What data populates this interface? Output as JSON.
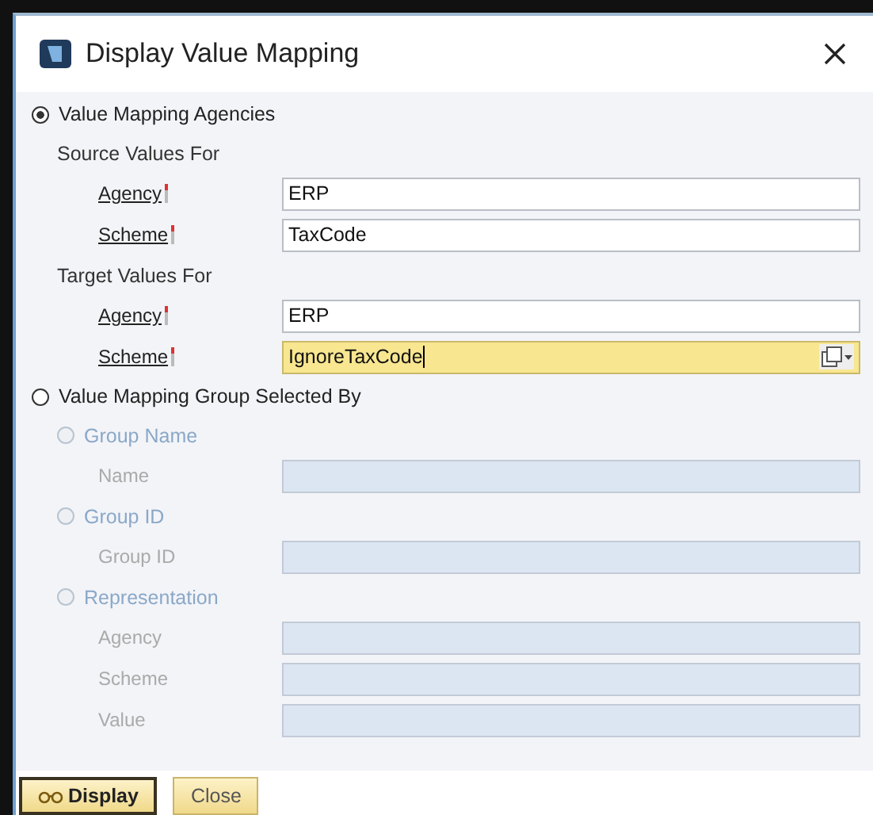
{
  "window": {
    "title": "Display Value Mapping"
  },
  "options": [
    {
      "label": "Value Mapping Agencies",
      "selected": true,
      "disabled": false,
      "groups": [
        {
          "heading": "Source Values For",
          "fields": [
            {
              "label": "Agency",
              "required": true,
              "value": "ERP",
              "disabled": false,
              "focused": false
            },
            {
              "label": "Scheme",
              "required": true,
              "value": "TaxCode",
              "disabled": false,
              "focused": false
            }
          ]
        },
        {
          "heading": "Target Values For",
          "fields": [
            {
              "label": "Agency",
              "required": true,
              "value": "ERP",
              "disabled": false,
              "focused": false
            },
            {
              "label": "Scheme",
              "required": true,
              "value": "IgnoreTaxCode",
              "disabled": false,
              "focused": true
            }
          ]
        }
      ]
    },
    {
      "label": "Value Mapping Group Selected By",
      "selected": false,
      "disabled": false,
      "groups": [
        {
          "heading": "Group Name",
          "selected": false,
          "disabled": true,
          "fields": [
            {
              "label": "Name",
              "required": false,
              "disabled": true,
              "focused": false
            }
          ]
        },
        {
          "heading": "Group ID",
          "selected": false,
          "disabled": true,
          "fields": [
            {
              "label": "Group ID",
              "required": false,
              "disabled": true,
              "focused": false
            }
          ]
        },
        {
          "heading": "Representation",
          "selected": false,
          "disabled": true,
          "fields": [
            {
              "label": "Agency",
              "required": false,
              "disabled": true,
              "focused": false
            },
            {
              "label": "Scheme",
              "required": false,
              "disabled": true,
              "focused": false
            },
            {
              "label": "Value",
              "required": false,
              "disabled": true,
              "focused": false
            }
          ]
        }
      ]
    }
  ],
  "buttons": [
    {
      "label": "Display",
      "default": true
    },
    {
      "label": "Close",
      "default": false
    }
  ]
}
